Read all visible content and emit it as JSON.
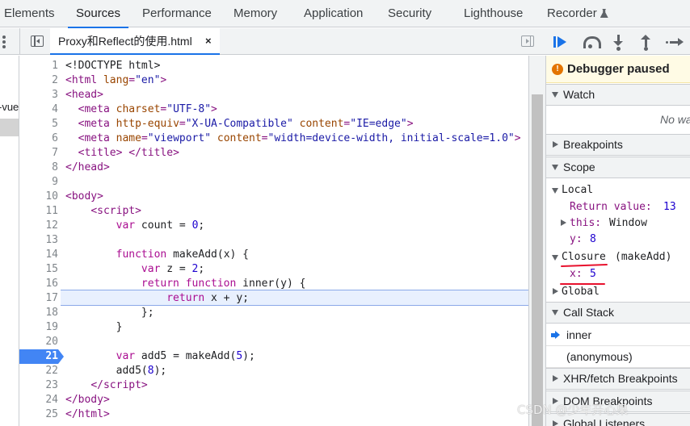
{
  "top_tabs": [
    "Elements",
    "Sources",
    "Performance",
    "Memory",
    "Application",
    "Security",
    "Lighthouse",
    "Recorder"
  ],
  "active_tab": "Sources",
  "navigator_fragment": "-vue",
  "editor": {
    "file_tab": "Proxy和Reflect的使用.html",
    "close_glyph": "×",
    "line_numbers": [
      "1",
      "2",
      "3",
      "4",
      "5",
      "6",
      "7",
      "8",
      "9",
      "10",
      "11",
      "12",
      "13",
      "14",
      "15",
      "16",
      "17",
      "18",
      "19",
      "20",
      "21",
      "22",
      "23",
      "24",
      "25"
    ],
    "breakpoint_line": "21",
    "execution_line": "17"
  },
  "debugger": {
    "paused_icon": "!",
    "paused_label": "Debugger paused",
    "watch": {
      "title": "Watch",
      "empty_text": "No watch expressions"
    },
    "breakpoints_title": "Breakpoints",
    "scope": {
      "title": "Scope",
      "local": {
        "title": "Local",
        "return_label": "Return value:",
        "return_value": "13",
        "this_label": "this:",
        "this_value": "Window",
        "y_label": "y:",
        "y_value": "8"
      },
      "closure": {
        "title": "Closure",
        "subtitle": "(makeAdd)",
        "x_label": "x:",
        "x_value": "5"
      },
      "global_title": "Global"
    },
    "call_stack": {
      "title": "Call Stack",
      "frames": [
        "inner",
        "(anonymous)"
      ]
    },
    "xhr_title": "XHR/fetch Breakpoints",
    "dom_title": "DOM Breakpoints",
    "global_listeners_title": "Global Listeners"
  },
  "watermark": "CSDN @少年开心果",
  "colors": {
    "accent": "#1a73e8",
    "breakpoint": "#4285f4",
    "annotation": "#e8112d",
    "paused_bg": "#fffbe5"
  }
}
